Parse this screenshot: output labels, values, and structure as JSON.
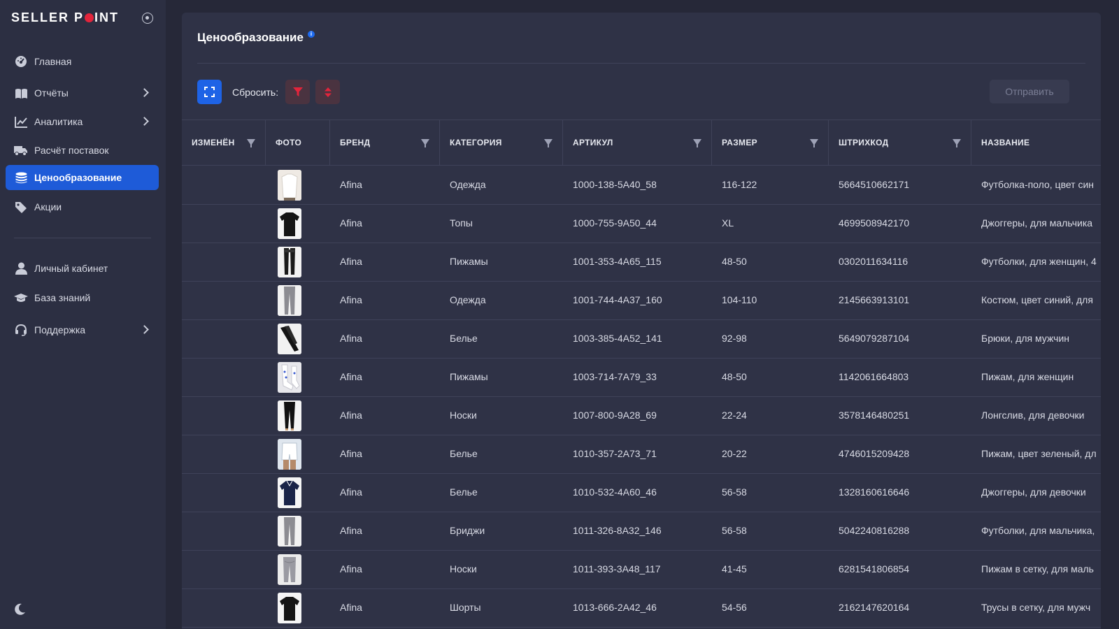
{
  "sidebar": {
    "logo_left": "SELLER P",
    "logo_right": "INT",
    "items": [
      {
        "label": "Главная",
        "icon": "dashboard-icon"
      },
      {
        "label": "Отчёты",
        "icon": "book-icon"
      },
      {
        "label": "Аналитика",
        "icon": "chart-line-icon"
      },
      {
        "label": "Расчёт поставок",
        "icon": "truck-icon"
      },
      {
        "label": "Ценообразование",
        "icon": "coins-icon"
      },
      {
        "label": "Акции",
        "icon": "tags-icon"
      },
      {
        "label": "Личный кабинет",
        "icon": "user-icon"
      },
      {
        "label": "База знаний",
        "icon": "graduation-cap-icon"
      },
      {
        "label": "Поддержка",
        "icon": "headset-icon"
      }
    ],
    "active_item": "Ценообразование"
  },
  "page": {
    "title": "Ценообразование",
    "info": "i"
  },
  "toolbar": {
    "reset_label": "Сбросить:",
    "send_label": "Отправить"
  },
  "colors": {
    "accent": "#1e5bd8",
    "danger": "#e3243b",
    "background": "#262838",
    "panel": "#2f3246"
  },
  "table": {
    "columns": [
      "ИЗМЕНЁН",
      "ФОТО",
      "БРЕНД",
      "КАТЕГОРИЯ",
      "АРТИКУЛ",
      "РАЗМЕР",
      "ШТРИХКОД",
      "НАЗВАНИЕ"
    ],
    "rows": [
      {
        "changed": "",
        "photo": "white-shirt",
        "brand": "Afina",
        "category": "Одежда",
        "sku": "1000-138-5A40_58",
        "size": "116-122",
        "barcode": "5664510662171",
        "name": "Футболка-поло, цвет син"
      },
      {
        "changed": "",
        "photo": "black-tshirt",
        "brand": "Afina",
        "category": "Топы",
        "sku": "1000-755-9A50_44",
        "size": "XL",
        "barcode": "4699508942170",
        "name": "Джоггеры, для мальчика"
      },
      {
        "changed": "",
        "photo": "black-stockings",
        "brand": "Afina",
        "category": "Пижамы",
        "sku": "1001-353-4A65_115",
        "size": "48-50",
        "barcode": "0302011634116",
        "name": "Футболки, для женщин, 4"
      },
      {
        "changed": "",
        "photo": "grey-pants",
        "brand": "Afina",
        "category": "Одежда",
        "sku": "1001-744-4A37_160",
        "size": "104-110",
        "barcode": "2145663913101",
        "name": "Костюм, цвет синий, для"
      },
      {
        "changed": "",
        "photo": "black-pants-lying",
        "brand": "Afina",
        "category": "Белье",
        "sku": "1003-385-4A52_141",
        "size": "92-98",
        "barcode": "5649079287104",
        "name": "Брюки, для мужчин"
      },
      {
        "changed": "",
        "photo": "white-socks",
        "brand": "Afina",
        "category": "Пижамы",
        "sku": "1003-714-7A79_33",
        "size": "48-50",
        "barcode": "1142061664803",
        "name": "Пижам, для женщин"
      },
      {
        "changed": "",
        "photo": "black-leggings",
        "brand": "Afina",
        "category": "Носки",
        "sku": "1007-800-9A28_69",
        "size": "22-24",
        "barcode": "3578146480251",
        "name": "Лонгслив, для девочки"
      },
      {
        "changed": "",
        "photo": "white-shorts",
        "brand": "Afina",
        "category": "Белье",
        "sku": "1010-357-2A73_71",
        "size": "20-22",
        "barcode": "4746015209428",
        "name": "Пижам, цвет зеленый, дл"
      },
      {
        "changed": "",
        "photo": "navy-polo",
        "brand": "Afina",
        "category": "Белье",
        "sku": "1010-532-4A60_46",
        "size": "56-58",
        "barcode": "1328160616646",
        "name": "Джоггеры, для девочки"
      },
      {
        "changed": "",
        "photo": "grey-pants",
        "brand": "Afina",
        "category": "Бриджи",
        "sku": "1011-326-8A32_146",
        "size": "56-58",
        "barcode": "5042240816288",
        "name": "Футболки, для мальчика,"
      },
      {
        "changed": "",
        "photo": "grey-leggings",
        "brand": "Afina",
        "category": "Носки",
        "sku": "1011-393-3A48_117",
        "size": "41-45",
        "barcode": "6281541806854",
        "name": "Пижам в сетку, для маль"
      },
      {
        "changed": "",
        "photo": "black-tshirt",
        "brand": "Afina",
        "category": "Шорты",
        "sku": "1013-666-2A42_46",
        "size": "54-56",
        "barcode": "2162147620164",
        "name": "Трусы в сетку, для мужч"
      }
    ]
  }
}
